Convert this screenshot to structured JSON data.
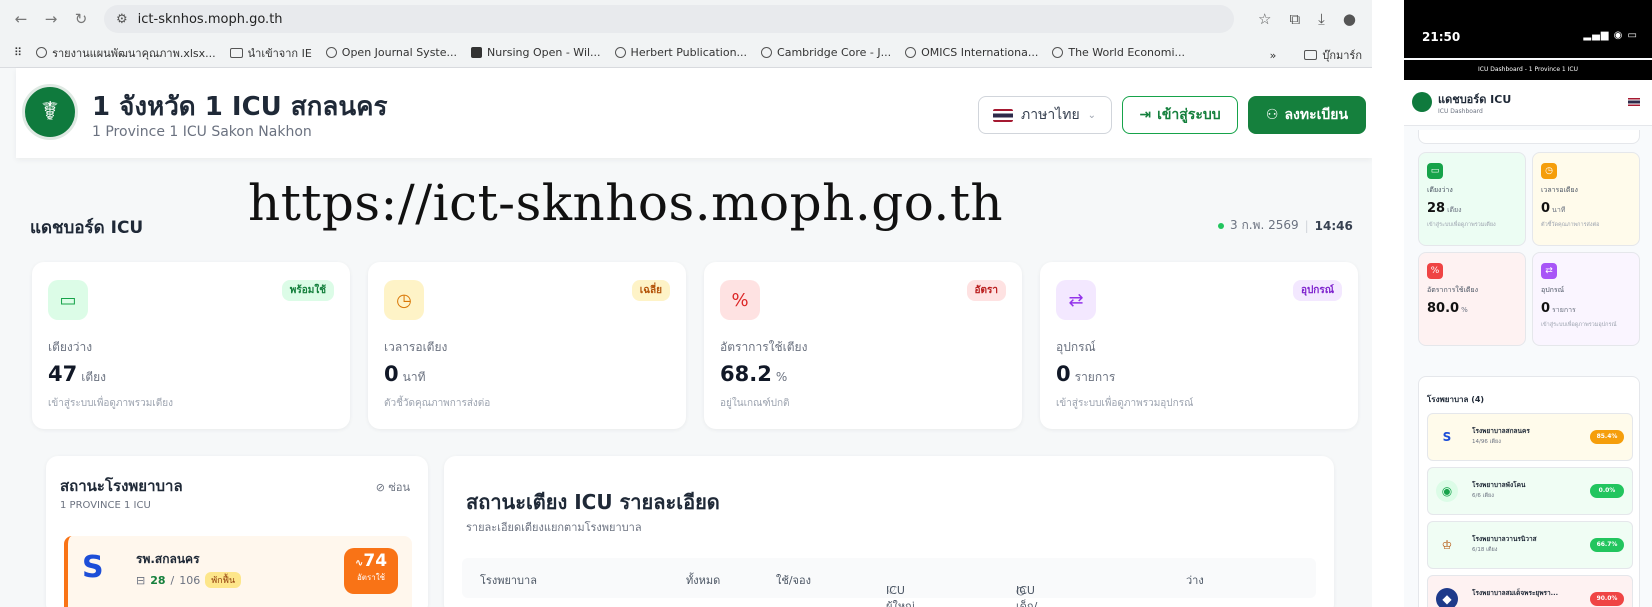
{
  "browser": {
    "url": "ict-sknhos.moph.go.th",
    "bookmarks": [
      "รายงานแผนพัฒนาคุณภาพ.xlsx...",
      "นำเข้าจาก IE",
      "Open Journal Syste...",
      "Nursing Open - Wil...",
      "Herbert Publication...",
      "Cambridge Core - J...",
      "OMICS Internationa...",
      "The World Economi..."
    ],
    "bookmark_more": "»",
    "bookmark_folder": "บุ๊กมาร์ก"
  },
  "site": {
    "title": "1 จังหวัด 1 ICU สกลนคร",
    "subtitle": "1 Province 1 ICU Sakon Nakhon",
    "language": "ภาษาไทย",
    "login": "เข้าสู่ระบบ",
    "register": "ลงทะเบียน"
  },
  "overlay_url": "https://ict-sknhos.moph.go.th",
  "dashboard": {
    "title": "แดชบอร์ด ICU",
    "date": "3 ก.พ. 2569",
    "time": "14:46"
  },
  "stats": [
    {
      "label": "เตียงว่าง",
      "value": "47",
      "unit": "เตียง",
      "note": "เข้าสู่ระบบเพื่อดูภาพรวมเตียง",
      "badge": "พร้อมใช้",
      "icon": "bed-icon",
      "color": "#16a34a"
    },
    {
      "label": "เวลารอเตียง",
      "value": "0",
      "unit": "นาที",
      "note": "ตัวชี้วัดคุณภาพการส่งต่อ",
      "badge": "เฉลี่ย",
      "icon": "clock-icon",
      "color": "#d97706"
    },
    {
      "label": "อัตราการใช้เตียง",
      "value": "68.2",
      "unit": "%",
      "note": "อยู่ในเกณฑ์ปกติ",
      "badge": "อัตรา",
      "icon": "percent-icon",
      "color": "#dc2626"
    },
    {
      "label": "อุปกรณ์",
      "value": "0",
      "unit": "รายการ",
      "note": "เข้าสู่ระบบเพื่อดูภาพรวมอุปกรณ์",
      "badge": "อุปกรณ์",
      "icon": "equipment-icon",
      "color": "#9333ea"
    }
  ],
  "hospital_panel": {
    "title": "สถานะโรงพยาบาล",
    "subtitle": "1 PROVINCE 1 ICU",
    "hide": "ซ่อน",
    "card": {
      "name": "รพ.สกลนคร",
      "beds_available": "28",
      "beds_total": "106",
      "tag": "พักฟื้น",
      "pct": "74",
      "pct_label": "อัตราใช้"
    }
  },
  "detail_panel": {
    "title": "สถานะเตียง ICU รายละเอียด",
    "subtitle": "รายละเอียดเตียงแยกตามโรงพยาบาล",
    "columns": [
      "โรงพยาบาล",
      "ทั้งหมด",
      "ใช้/จอง",
      "ICU ผู้ใหญ่",
      "ICU เด็ก/ทารก",
      "ว่าง"
    ]
  },
  "phone": {
    "time": "21:50",
    "tab": "ICU Dashboard - 1 Province 1 ICU",
    "title": "แดชบอร์ด ICU",
    "subtitle": "ICU Dashboard",
    "cards": [
      {
        "label": "เตียงว่าง",
        "value": "28",
        "unit": "เตียง",
        "note": "เข้าสู่ระบบเพื่อดูภาพรวมเตียง",
        "color": "#16a34a",
        "bg": "#ecfdf3"
      },
      {
        "label": "เวลารอเตียง",
        "value": "0",
        "unit": "นาที",
        "note": "ตัวชี้วัดคุณภาพการส่งต่อ",
        "color": "#f59e0b",
        "bg": "#fffbeb"
      },
      {
        "label": "อัตราการใช้เตียง",
        "value": "80.0",
        "unit": "%",
        "note": "",
        "color": "#ef4444",
        "bg": "#fef2f2"
      },
      {
        "label": "อุปกรณ์",
        "value": "0",
        "unit": "รายการ",
        "note": "เข้าสู่ระบบเพื่อดูภาพรวมอุปกรณ์",
        "color": "#a855f7",
        "bg": "#faf5ff"
      }
    ],
    "hospitals_title": "โรงพยาบาล (4)",
    "hospitals": [
      {
        "name": "โรงพยาบาลสกลนคร",
        "beds": "14/96 เตียง",
        "pct": "85.4%",
        "color": "#f59e0b",
        "bg": "#fffbeb"
      },
      {
        "name": "โรงพยาบาลพังโคน",
        "beds": "6/6 เตียง",
        "pct": "0.0%",
        "color": "#22c55e",
        "bg": "#f0fdf4"
      },
      {
        "name": "โรงพยาบาลวานรนิวาส",
        "beds": "6/18 เตียง",
        "pct": "66.7%",
        "color": "#22c55e",
        "bg": "#f0fdf4"
      },
      {
        "name": "โรงพยาบาลสมเด็จพระยุพรา...",
        "beds": "",
        "pct": "90.0%",
        "color": "#ef4444",
        "bg": "#fef2f2"
      }
    ]
  }
}
